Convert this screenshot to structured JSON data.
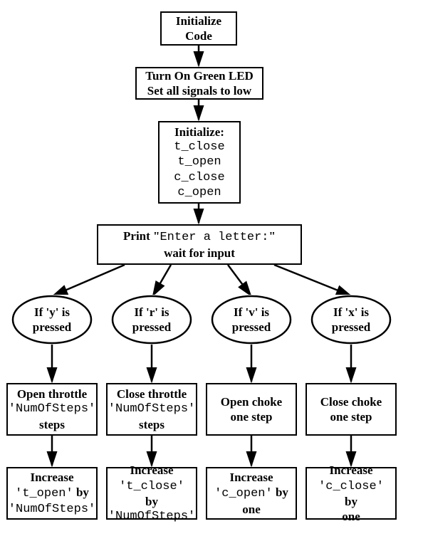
{
  "chart_data": {
    "type": "flowchart",
    "nodes": [
      {
        "id": "init",
        "shape": "rect",
        "text": "Initialize Code"
      },
      {
        "id": "led",
        "shape": "rect",
        "text": "Turn On Green LED / Set all signals to low"
      },
      {
        "id": "initvars",
        "shape": "rect",
        "text": "Initialize: t_close t_open c_close c_open"
      },
      {
        "id": "prompt",
        "shape": "rect",
        "text": "Print \"Enter a letter:\" wait for input"
      },
      {
        "id": "y",
        "shape": "ellipse",
        "text": "If 'y' is pressed"
      },
      {
        "id": "r",
        "shape": "ellipse",
        "text": "If 'r' is pressed"
      },
      {
        "id": "v",
        "shape": "ellipse",
        "text": "If 'v' is pressed"
      },
      {
        "id": "x",
        "shape": "ellipse",
        "text": "If 'x' is pressed"
      },
      {
        "id": "ya",
        "shape": "rect",
        "text": "Open throttle 'NumOfSteps' steps"
      },
      {
        "id": "ra",
        "shape": "rect",
        "text": "Close throttle 'NumOfSteps' steps"
      },
      {
        "id": "va",
        "shape": "rect",
        "text": "Open choke one step"
      },
      {
        "id": "xa",
        "shape": "rect",
        "text": "Close choke one step"
      },
      {
        "id": "yb",
        "shape": "rect",
        "text": "Increase 't_open' by 'NumOfSteps'"
      },
      {
        "id": "rb",
        "shape": "rect",
        "text": "Increase 't_close' by 'NumOfSteps'"
      },
      {
        "id": "vb",
        "shape": "rect",
        "text": "Increase 'c_open' by one"
      },
      {
        "id": "xb",
        "shape": "rect",
        "text": "Increase 'c_close' by one"
      }
    ],
    "edges": [
      [
        "init",
        "led"
      ],
      [
        "led",
        "initvars"
      ],
      [
        "initvars",
        "prompt"
      ],
      [
        "prompt",
        "y"
      ],
      [
        "prompt",
        "r"
      ],
      [
        "prompt",
        "v"
      ],
      [
        "prompt",
        "x"
      ],
      [
        "y",
        "ya"
      ],
      [
        "r",
        "ra"
      ],
      [
        "v",
        "va"
      ],
      [
        "x",
        "xa"
      ],
      [
        "ya",
        "yb"
      ],
      [
        "ra",
        "rb"
      ],
      [
        "va",
        "vb"
      ],
      [
        "xa",
        "xb"
      ]
    ]
  },
  "nodes": {
    "init": {
      "line1": "Initialize",
      "line2": "Code"
    },
    "led": {
      "line1": "Turn On Green LED",
      "line2": "Set all signals to low"
    },
    "initvars": {
      "title": "Initialize:",
      "v1": "t_close",
      "v2": "t_open",
      "v3": "c_close",
      "v4": "c_open"
    },
    "prompt": {
      "pre": "Print \"",
      "code": "Enter a letter:",
      "post": "\"",
      "line2": "wait for input"
    },
    "cond_y": {
      "line1": "If 'y' is",
      "line2": "pressed"
    },
    "cond_r": {
      "line1": "If 'r' is",
      "line2": "pressed"
    },
    "cond_v": {
      "line1": "If 'v' is",
      "line2": "pressed"
    },
    "cond_x": {
      "line1": "If 'x' is",
      "line2": "pressed"
    },
    "act_y1": {
      "line1": "Open throttle",
      "code": "'NumOfSteps'",
      "line3": "steps"
    },
    "act_r1": {
      "line1": "Close throttle",
      "code": "'NumOfSteps'",
      "line3": "steps"
    },
    "act_v1": {
      "line1": "Open choke",
      "line2": "one step"
    },
    "act_x1": {
      "line1": "Close choke",
      "line2": "one step"
    },
    "act_y2": {
      "line1": "Increase",
      "code1": "'t_open'",
      "mid": " by",
      "code2": "'NumOfSteps'"
    },
    "act_r2": {
      "line1": "Increase",
      "code1": "'t_close'",
      "mid": " by",
      "code2": "'NumOfSteps'"
    },
    "act_v2": {
      "line1": "Increase",
      "code1": "'c_open'",
      "mid": " by",
      "line3": "one"
    },
    "act_x2": {
      "line1": "Increase",
      "code1": "'c_close'",
      "mid": " by",
      "line3": "one"
    }
  }
}
